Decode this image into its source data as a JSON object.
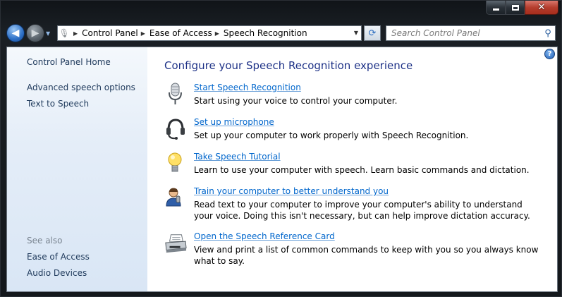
{
  "window": {
    "minimize_glyph": "minimize-icon",
    "maximize_glyph": "maximize-icon",
    "close_glyph": "close-icon"
  },
  "address_bar": {
    "breadcrumbs": [
      "Control Panel",
      "Ease of Access",
      "Speech Recognition"
    ]
  },
  "search": {
    "placeholder": "Search Control Panel"
  },
  "sidebar": {
    "home": "Control Panel Home",
    "links": [
      "Advanced speech options",
      "Text to Speech"
    ],
    "see_also_label": "See also",
    "see_also": [
      "Ease of Access",
      "Audio Devices"
    ]
  },
  "main": {
    "title": "Configure your Speech Recognition experience",
    "tasks": [
      {
        "label": "Start Speech Recognition",
        "description": "Start using your voice to control your computer.",
        "icon": "microphone-icon"
      },
      {
        "label": "Set up microphone",
        "description": "Set up your computer to work properly with Speech Recognition.",
        "icon": "headset-icon"
      },
      {
        "label": "Take Speech Tutorial",
        "description": "Learn to use your computer with speech.  Learn basic commands and dictation.",
        "icon": "lightbulb-icon"
      },
      {
        "label": "Train your computer to better understand you",
        "description": "Read text to your computer to improve your computer's ability to understand your voice. Doing this isn't necessary, but can help improve dictation accuracy.",
        "icon": "user-speaking-icon"
      },
      {
        "label": "Open the Speech Reference Card",
        "description": "View and print a list of common commands to keep with you so you always know what to say.",
        "icon": "printer-icon"
      }
    ]
  },
  "colors": {
    "link": "#0066cc",
    "title": "#1e3287",
    "sidebar_link": "#1e395b",
    "close_button": "#b53e2e"
  }
}
